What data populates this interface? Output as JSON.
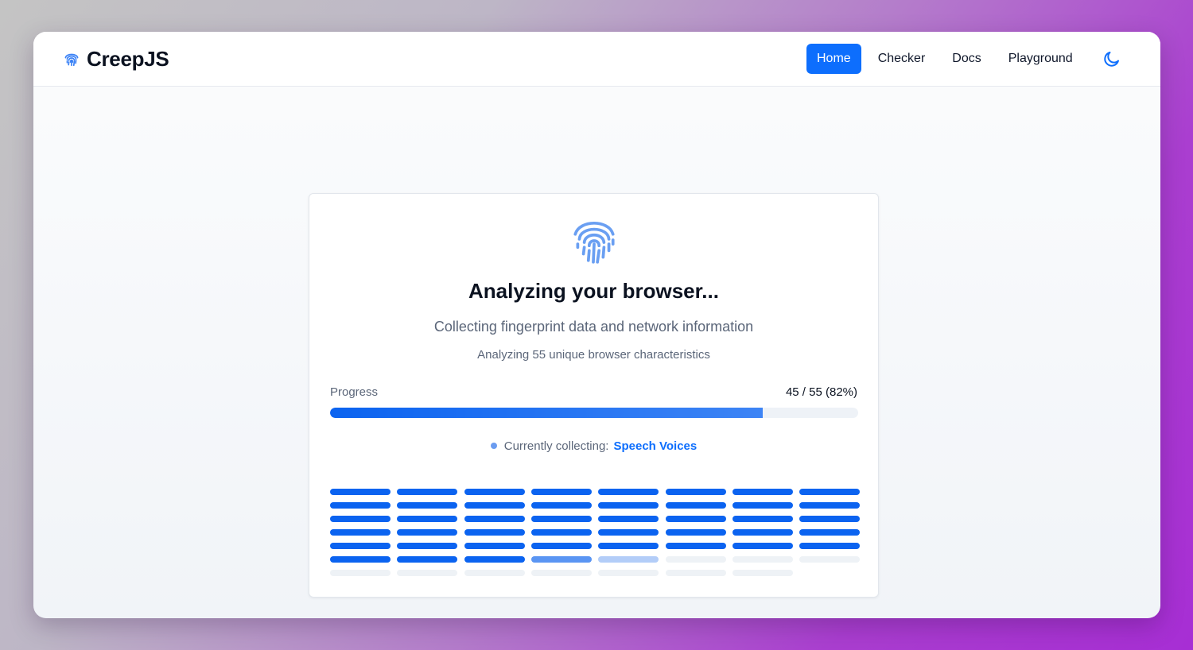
{
  "brand": {
    "name": "CreepJS",
    "icon": "fingerprint-icon"
  },
  "nav": {
    "items": [
      {
        "label": "Home",
        "active": true
      },
      {
        "label": "Checker",
        "active": false
      },
      {
        "label": "Docs",
        "active": false
      },
      {
        "label": "Playground",
        "active": false
      }
    ],
    "theme_icon": "moon-icon"
  },
  "card": {
    "icon": "fingerprint-icon",
    "title": "Analyzing your browser...",
    "subtitle": "Collecting fingerprint data and network information",
    "detail": "Analyzing 55 unique browser characteristics",
    "progress": {
      "label": "Progress",
      "count_text": "45 / 55 (82%)",
      "completed": 45,
      "total": 55,
      "fraction": 0.82
    },
    "collecting": {
      "label": "Currently collecting:",
      "value": "Speech Voices"
    },
    "grid": {
      "columns": 8,
      "rows": 7,
      "rows_states": [
        [
          "done",
          "done",
          "done",
          "done",
          "done",
          "done",
          "done",
          "done"
        ],
        [
          "done",
          "done",
          "done",
          "done",
          "done",
          "done",
          "done",
          "done"
        ],
        [
          "done",
          "done",
          "done",
          "done",
          "done",
          "done",
          "done",
          "done"
        ],
        [
          "done",
          "done",
          "done",
          "done",
          "done",
          "done",
          "done",
          "done"
        ],
        [
          "done",
          "done",
          "done",
          "done",
          "done",
          "done",
          "done",
          "done"
        ],
        [
          "done",
          "done",
          "done",
          "active",
          "queued",
          "pending",
          "pending",
          "pending"
        ],
        [
          "pending",
          "pending",
          "pending",
          "pending",
          "pending",
          "pending",
          "pending"
        ]
      ]
    }
  },
  "colors": {
    "accent": "#0d6efd",
    "progress_fill": "#0b63f0",
    "text_dark": "#0b1220",
    "text_muted": "#5b6679"
  }
}
